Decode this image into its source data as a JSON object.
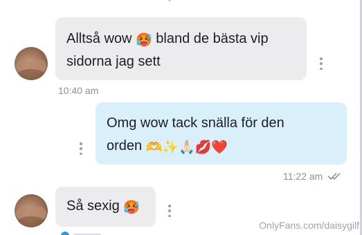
{
  "messages": [
    {
      "direction": "incoming",
      "text_line1": "Alltså wow",
      "emoji1": "🥵",
      "text_line1b": "bland de bästa vip",
      "text_line2": "sidorna jag sett",
      "time": "10:40 am"
    },
    {
      "direction": "outgoing",
      "text_line1": "Omg wow tack snälla för den",
      "text_line2": "orden",
      "emojis": "🫶✨🙏🏻💋❤️",
      "time": "11:22 am",
      "read_icon": "double-check-icon"
    },
    {
      "direction": "incoming",
      "text": "Så sexig",
      "emoji": "🥵"
    }
  ],
  "watermark": "OnlyFans.com/daisygilf",
  "colors": {
    "incoming_bubble": "#ececef",
    "outgoing_bubble": "#d9f0fb",
    "time_text": "#8a9099",
    "like_accent": "#2a9ad8"
  }
}
